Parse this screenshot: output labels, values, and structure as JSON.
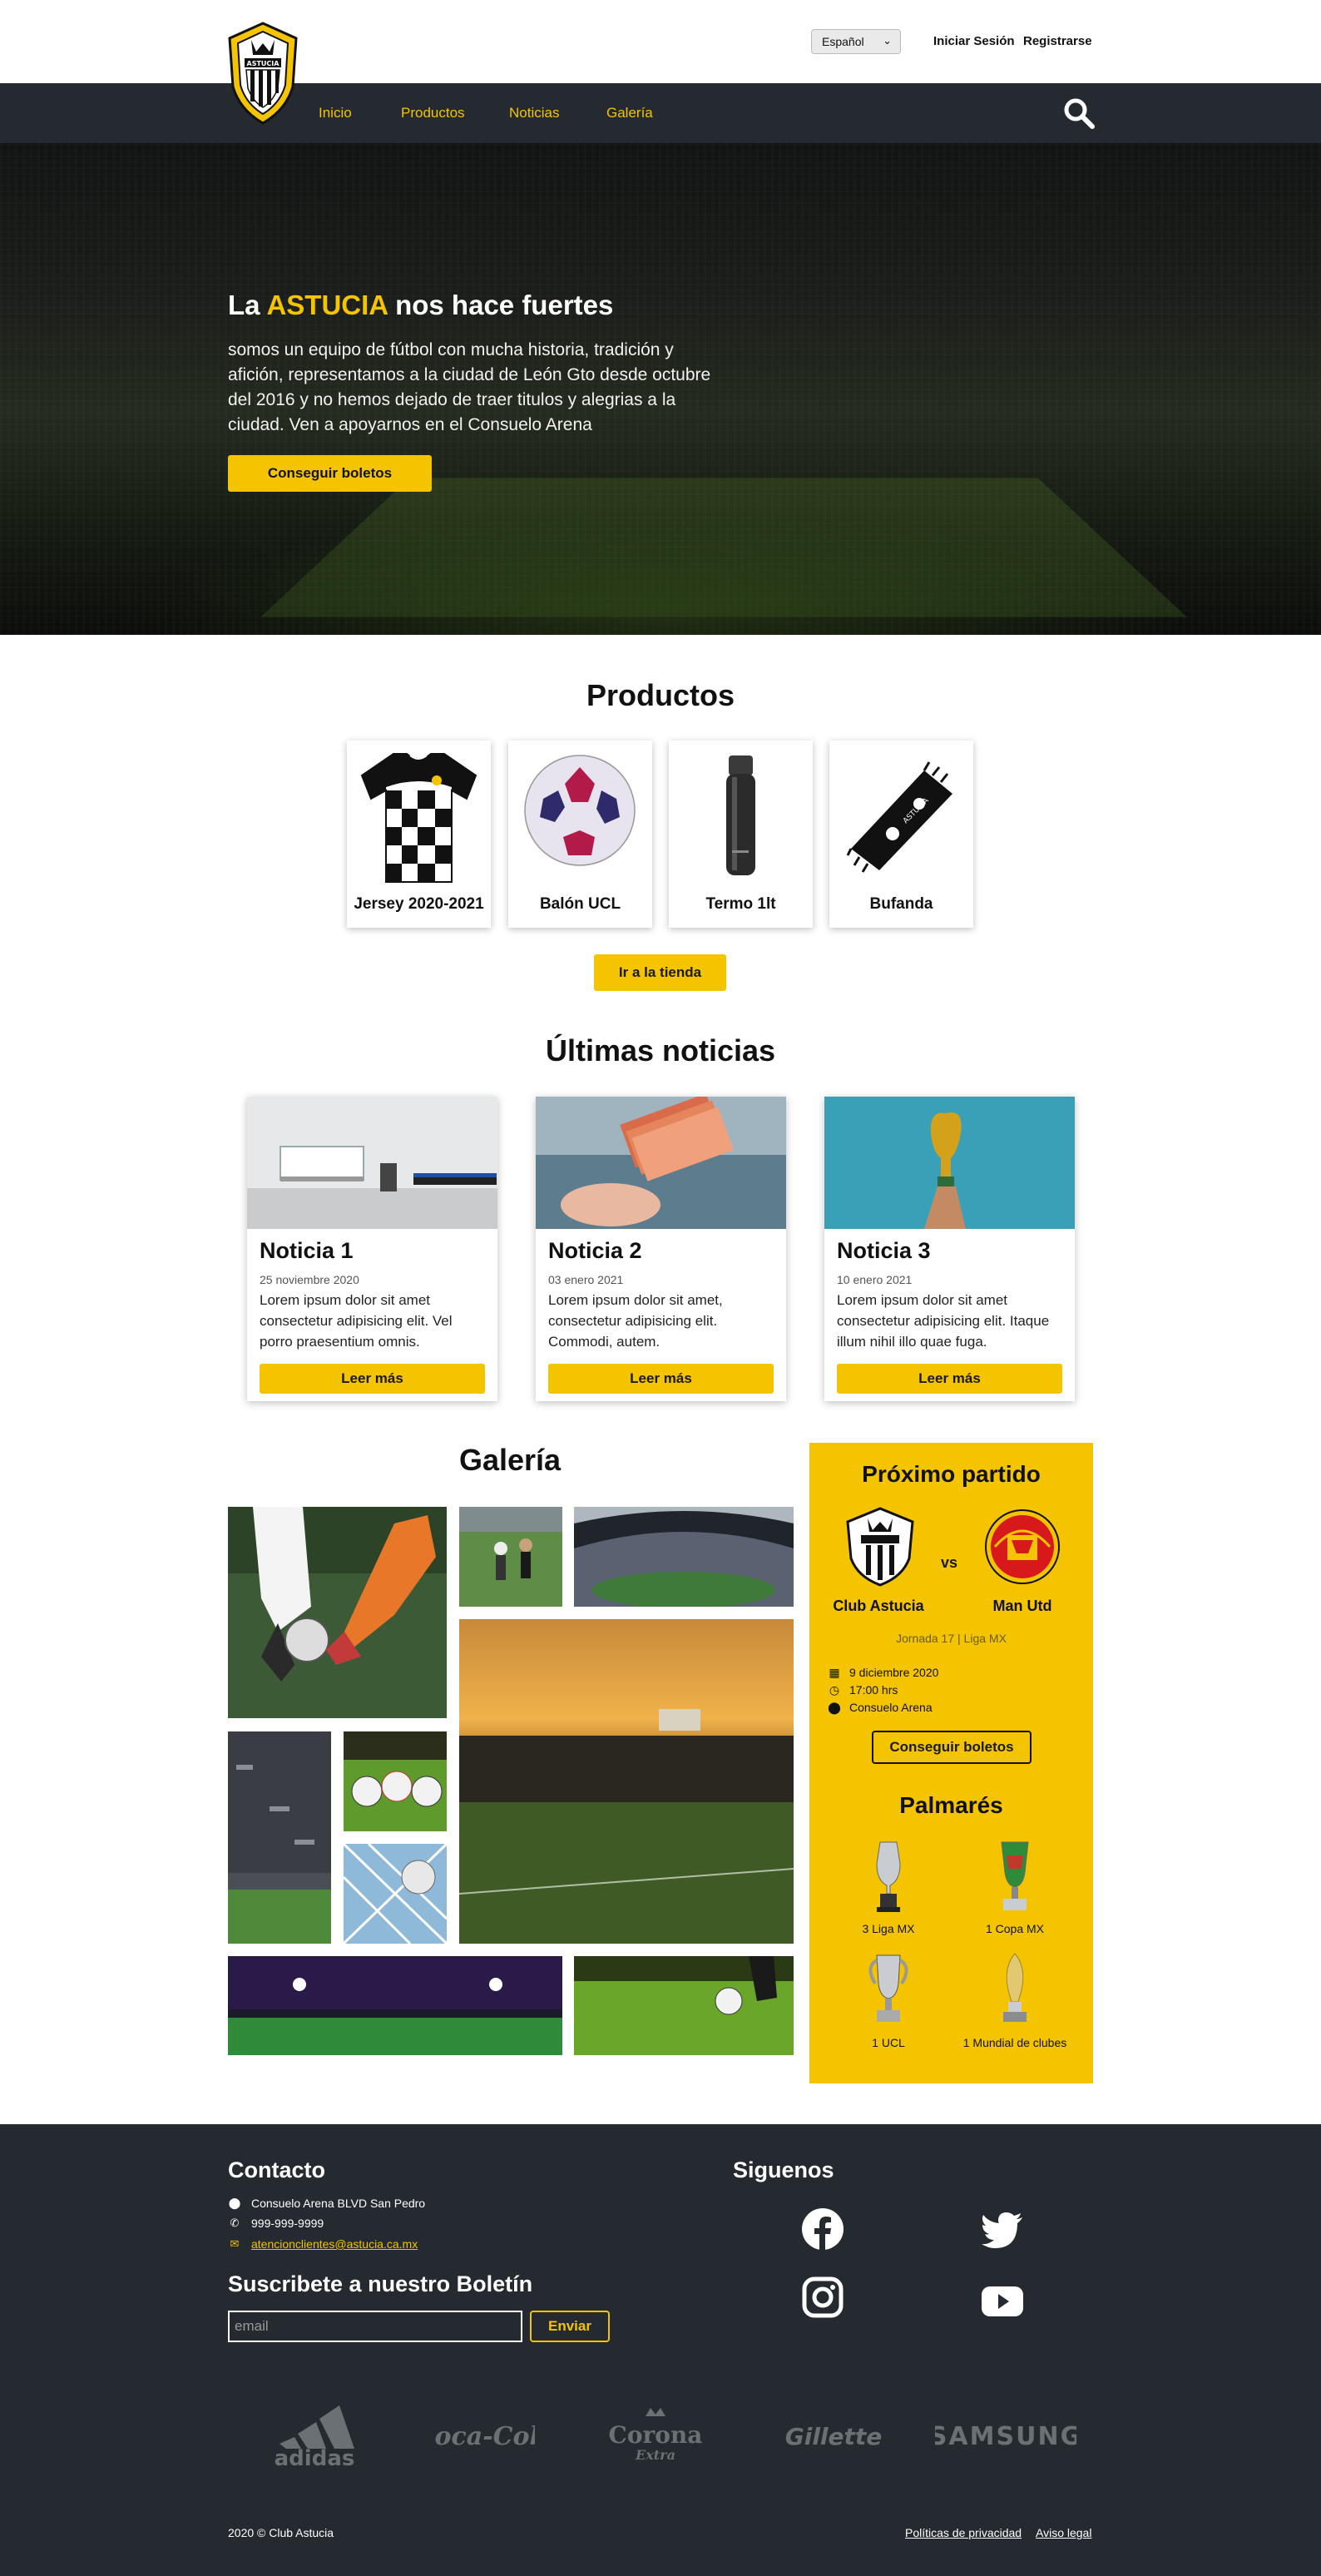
{
  "header": {
    "language": "Español",
    "login_label": "Iniciar Sesión",
    "register_label": "Registrarse",
    "logo_text": "ASTUCIA",
    "nav": [
      "Inicio",
      "Productos",
      "Noticias",
      "Galería"
    ]
  },
  "hero": {
    "title_prefix": "La ",
    "title_accent": "ASTUCIA",
    "title_suffix": " nos hace fuertes",
    "text": "somos un equipo de fútbol con mucha historia, tradición y afición, representamos a la ciudad de León Gto desde octubre del 2016 y no hemos dejado de traer titulos y alegrias a la ciudad. Ven a apoyarnos en el Consuelo Arena",
    "cta": "Conseguir boletos"
  },
  "products": {
    "title": "Productos",
    "items": [
      {
        "name": "Jersey 2020-2021",
        "icon": "jersey-icon"
      },
      {
        "name": "Balón UCL",
        "icon": "ball-icon"
      },
      {
        "name": "Termo 1lt",
        "icon": "thermos-icon"
      },
      {
        "name": "Bufanda",
        "icon": "scarf-icon"
      }
    ],
    "shop_button": "Ir a la tienda"
  },
  "news": {
    "title": "Últimas noticias",
    "items": [
      {
        "title": "Noticia 1",
        "date": "25 noviembre 2020",
        "text": "Lorem ipsum dolor sit amet consectetur adipisicing elit. Vel porro praesentium omnis.",
        "button": "Leer más"
      },
      {
        "title": "Noticia 2",
        "date": "03 enero 2021",
        "text": "Lorem ipsum dolor sit amet, consectetur adipisicing elit. Commodi, autem.",
        "button": "Leer más"
      },
      {
        "title": "Noticia 3",
        "date": "10 enero 2021",
        "text": "Lorem ipsum dolor sit amet consectetur adipisicing elit. Itaque illum nihil illo quae fuga.",
        "button": "Leer más"
      }
    ]
  },
  "gallery": {
    "title": "Galería"
  },
  "match": {
    "title": "Próximo partido",
    "home_team": "Club Astucia",
    "away_team": "Man Utd",
    "vs": "vs",
    "matchday": "Jornada 17 | Liga MX",
    "date": "9 diciembre 2020",
    "time": "17:00 hrs",
    "venue": "Consuelo Arena",
    "button": "Conseguir boletos"
  },
  "honours": {
    "title": "Palmarés",
    "items": [
      "3 Liga MX",
      "1 Copa MX",
      "1 UCL",
      "1 Mundial de clubes"
    ]
  },
  "footer": {
    "contact_title": "Contacto",
    "address": "Consuelo Arena BLVD San Pedro",
    "phone": "999-999-9999",
    "email": "atencionclientes@astucia.ca.mx",
    "newsletter_title": "Suscribete a nuestro Boletín",
    "email_placeholder": "email",
    "send_button": "Enviar",
    "social_title": "Siguenos",
    "brands": [
      "adidas",
      "Coca-Cola",
      "Corona",
      "Extra",
      "Gillette",
      "SAMSUNG"
    ],
    "copyright": "2020 © Club Astucia",
    "privacy": "Políticas de privacidad",
    "legal": "Aviso legal"
  },
  "colors": {
    "accent": "#f5c400",
    "dark": "#242a30"
  }
}
